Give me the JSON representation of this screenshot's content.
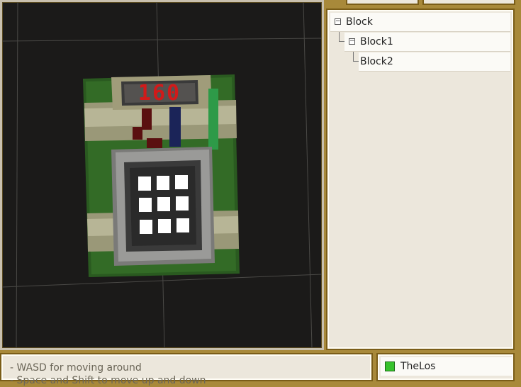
{
  "tree": {
    "items": [
      {
        "label": "Block",
        "level": 0,
        "expanded": true
      },
      {
        "label": "Block1",
        "level": 1,
        "expanded": true
      },
      {
        "label": "Block2",
        "level": 2,
        "expanded": false
      }
    ]
  },
  "bomb": {
    "display": "160"
  },
  "help": {
    "lines": [
      "- WASD for moving around",
      "- Space and Shift to move up and down"
    ]
  },
  "players": [
    {
      "name": "TheLos",
      "status_color": "#37c22c"
    }
  ],
  "colors": {
    "viewport_bg": "#1b1a19",
    "panel_bg": "#ece7dc",
    "border": "#7a5d18",
    "timer_red": "#d11a1a"
  }
}
